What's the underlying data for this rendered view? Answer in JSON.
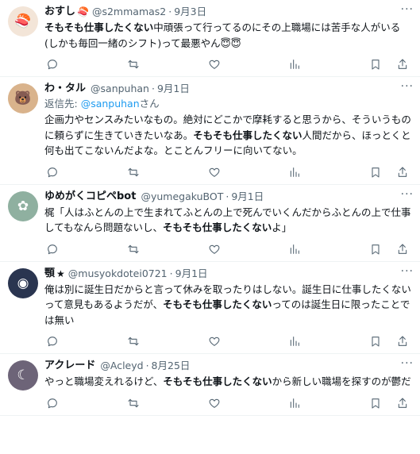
{
  "tweets": [
    {
      "name": "おすし",
      "name_emoji": "🍣",
      "handle": "@s2mmamas2",
      "date": "9月3日",
      "avatar_glyph": "🍣",
      "avatar_color": "#f3e5d8",
      "reply_label": "",
      "reply_mention": "",
      "reply_suffix": "",
      "segments": [
        {
          "t": "そもそも仕事したくない",
          "b": true
        },
        {
          "t": "中頑張って行ってるのにその上職場には苦手な人がいる(しかも毎回一緒のシフト)って最悪やん😇😇",
          "b": false
        }
      ]
    },
    {
      "name": "わ・タル",
      "name_emoji": "",
      "handle": "@sanpuhan",
      "date": "9月1日",
      "avatar_glyph": "🐻",
      "avatar_color": "#d9b38c",
      "reply_label": "返信先: ",
      "reply_mention": "@sanpuhan",
      "reply_suffix": "さん",
      "segments": [
        {
          "t": "企画力やセンスみたいなもの。絶対にどこかで摩耗すると思うから、そういうものに頼らずに生きていきたいなあ。",
          "b": false
        },
        {
          "t": "そもそも仕事したくない",
          "b": true
        },
        {
          "t": "人間だから、ほっとくと何も出てこないんだよな。とことんフリーに向いてない。",
          "b": false
        }
      ]
    },
    {
      "name": "ゆめがくコピペbot",
      "name_emoji": "",
      "handle": "@yumegakuBOT",
      "date": "9月1日",
      "avatar_glyph": "✿",
      "avatar_color": "#8fb0a0",
      "reply_label": "",
      "reply_mention": "",
      "reply_suffix": "",
      "segments": [
        {
          "t": "梶「人はふとんの上で生まれてふとんの上で死んでいくんだからふとんの上で仕事してもなんら問題ないし、",
          "b": false
        },
        {
          "t": "そもそも仕事したくない",
          "b": true
        },
        {
          "t": "よ」",
          "b": false
        }
      ]
    },
    {
      "name": "顎",
      "name_emoji": "★",
      "handle": "@musyokdotei0721",
      "date": "9月1日",
      "avatar_glyph": "◉",
      "avatar_color": "#2a3550",
      "reply_label": "",
      "reply_mention": "",
      "reply_suffix": "",
      "segments": [
        {
          "t": "俺は別に誕生日だからと言って休みを取ったりはしない。誕生日に仕事したくない　って意見もあるようだが、",
          "b": false
        },
        {
          "t": "そもそも仕事したくない",
          "b": true
        },
        {
          "t": "ってのは誕生日に限ったことでは無い",
          "b": false
        }
      ]
    },
    {
      "name": "アクレード",
      "name_emoji": "",
      "handle": "@Acleyd",
      "date": "8月25日",
      "avatar_glyph": "☾",
      "avatar_color": "#6d6478",
      "reply_label": "",
      "reply_mention": "",
      "reply_suffix": "",
      "segments": [
        {
          "t": "やっと職場変えれるけど、",
          "b": false
        },
        {
          "t": "そもそも仕事したくない",
          "b": true
        },
        {
          "t": "から新しい職場を探すのが鬱だ",
          "b": false
        }
      ]
    }
  ],
  "icons": {
    "reply": "reply-icon",
    "retweet": "retweet-icon",
    "like": "like-icon",
    "views": "views-icon",
    "bookmark": "bookmark-icon",
    "share": "share-icon",
    "more": "more-icon"
  },
  "colors": {
    "text": "#0f1419",
    "secondary": "#536471",
    "link": "#1d9bf0",
    "divider": "#eff3f4"
  }
}
